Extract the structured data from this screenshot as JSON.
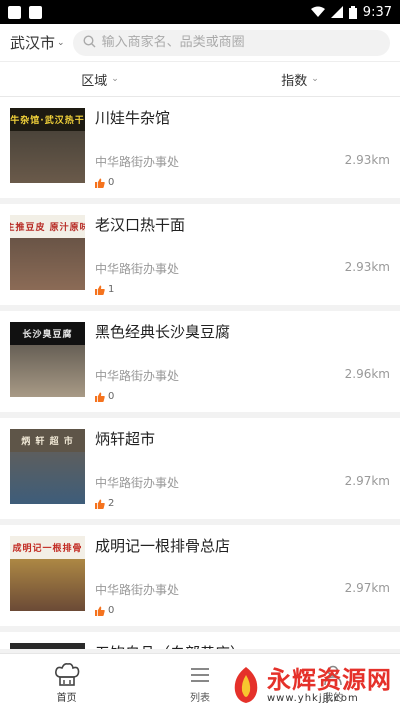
{
  "status_bar": {
    "time": "9:37"
  },
  "header": {
    "city": "武汉市",
    "search_placeholder": "输入商家名、品类或商圈"
  },
  "filters": [
    {
      "label": "区域"
    },
    {
      "label": "指数"
    }
  ],
  "shops": [
    {
      "name": "川娃牛杂馆",
      "area": "中华路街办事处",
      "distance": "2.93km",
      "likes": "0",
      "sign": "牛杂馆·武汉热干",
      "sign_bg": "#1d1a12",
      "sign_fg": "#f3d33a",
      "photo_top": "#3d3a33",
      "photo_bottom": "#6a5a4a"
    },
    {
      "name": "老汉口热干面",
      "area": "中华路街办事处",
      "distance": "2.93km",
      "likes": "1",
      "sign": "主推豆皮 原汁原味",
      "sign_bg": "#f2efe6",
      "sign_fg": "#b72a24",
      "photo_top": "#5a4a3f",
      "photo_bottom": "#8b6b56"
    },
    {
      "name": "黑色经典长沙臭豆腐",
      "area": "中华路街办事处",
      "distance": "2.96km",
      "likes": "0",
      "sign": "长沙臭豆腐",
      "sign_bg": "#111111",
      "sign_fg": "#e8e8e8",
      "photo_top": "#4a4640",
      "photo_bottom": "#a89a86"
    },
    {
      "name": "炳轩超市",
      "area": "中华路街办事处",
      "distance": "2.97km",
      "likes": "2",
      "sign": "炳 轩 超 市",
      "sign_bg": "#5e5548",
      "sign_fg": "#f1e9d6",
      "photo_top": "#6a5f52",
      "photo_bottom": "#3e5d7a"
    },
    {
      "name": "成明记一根排骨总店",
      "area": "中华路街办事处",
      "distance": "2.97km",
      "likes": "0",
      "sign": "成明记一根排骨",
      "sign_bg": "#f3efe6",
      "sign_fg": "#c22a22",
      "photo_top": "#caa34a",
      "photo_bottom": "#6b4a36"
    },
    {
      "name": "五饮自品（白部巷店）",
      "area": "",
      "distance": "",
      "likes": "",
      "sign": "",
      "sign_bg": "#2a2a2a",
      "sign_fg": "#ffffff",
      "photo_top": "#3a3a3a",
      "photo_bottom": "#555555"
    }
  ],
  "tabbar": {
    "tabs": [
      {
        "label": "首页"
      },
      {
        "label": "列表"
      },
      {
        "label": "我的"
      }
    ]
  },
  "watermark": {
    "text": "永辉资源网",
    "url": "www.yhkjjj.com"
  },
  "colors": {
    "accent": "#f08a24",
    "like_icon": "#f5731e",
    "watermark": "#e5312a"
  }
}
